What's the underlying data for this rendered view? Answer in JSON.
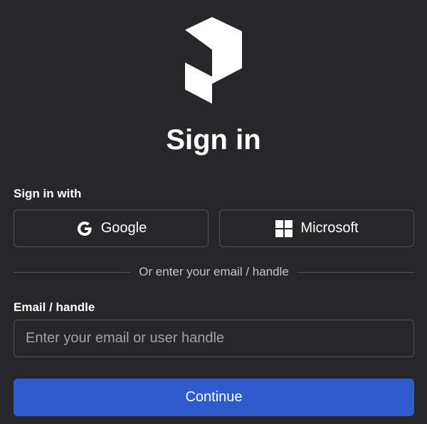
{
  "header": {
    "logo_icon": "prefect-logo-icon",
    "title": "Sign in"
  },
  "providers": {
    "label": "Sign in with",
    "google": {
      "label": "Google",
      "icon": "google-g-icon"
    },
    "microsoft": {
      "label": "Microsoft",
      "icon": "microsoft-windows-icon"
    }
  },
  "divider": {
    "text": "Or enter your email / handle"
  },
  "email": {
    "label": "Email / handle",
    "value": "",
    "placeholder": "Enter your email or user handle"
  },
  "actions": {
    "continue_label": "Continue"
  },
  "colors": {
    "background": "#27272a",
    "border": "#52525b",
    "primary": "#2e5bce",
    "text": "#ffffff",
    "muted_text": "#c4c4c9"
  }
}
